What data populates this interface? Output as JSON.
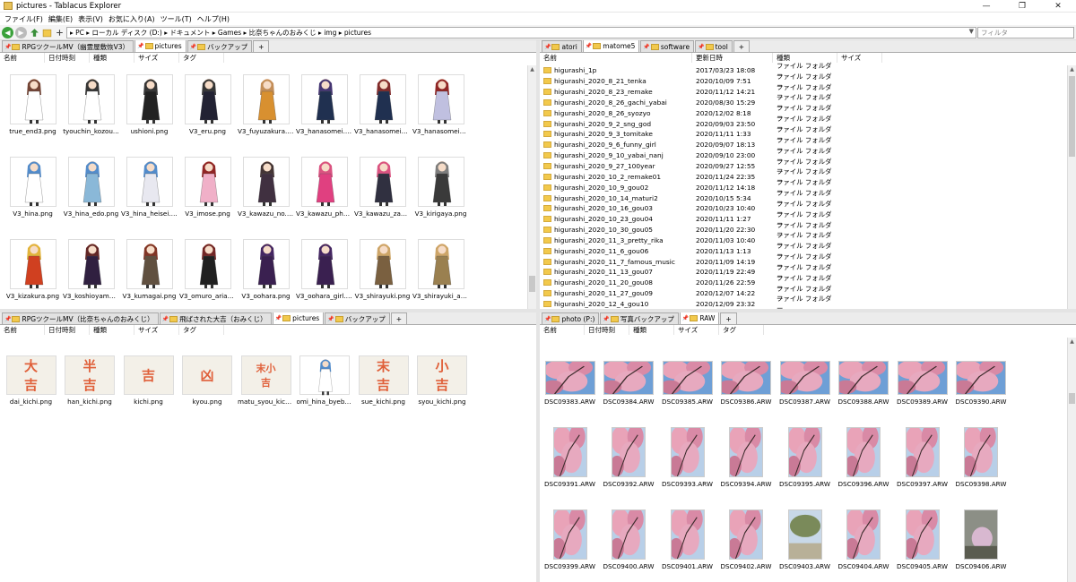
{
  "window": {
    "title": "pictures - Tablacus Explorer",
    "min": "—",
    "max": "❐",
    "close": "✕"
  },
  "menu": [
    "ファイル(F)",
    "編集(E)",
    "表示(V)",
    "お気に入り(A)",
    "ツール(T)",
    "ヘルプ(H)"
  ],
  "address": {
    "path": "▸ PC ▸ ローカル ディスク (D:) ▸ ドキュメント ▸ Games ▸ 比奈ちゃんのおみくじ ▸ img ▸ pictures",
    "filter_placeholder": "フィルタ"
  },
  "columns_icon": [
    "名前",
    "日付時刻",
    "種類",
    "サイズ",
    "タグ"
  ],
  "columns_detail": [
    "名前",
    "更新日時",
    "種類",
    "サイズ"
  ],
  "tl": {
    "tabs": [
      "RPGツクールMV（幽霊屋敷恢V3）",
      "pictures",
      "バックアップ",
      "+"
    ],
    "active": 1,
    "files": [
      "true_end3.png",
      "tyouchin_kozou...",
      "ushioni.png",
      "V3_eru.png",
      "V3_fuyuzakura.png",
      "V3_hanasomei.png",
      "V3_hanasomei_k...",
      "V3_hanasomei_s...",
      "V3_hina.png",
      "V3_hina_edo.png",
      "V3_hina_heisei.png",
      "V3_imose.png",
      "V3_kawazu_no.png",
      "V3_kawazu_phot...",
      "V3_kawazu_zakur...",
      "V3_kirigaya.png",
      "V3_kizakura.png",
      "V3_koshioyama....",
      "V3_kumagai.png",
      "V3_omuro_ariake...",
      "V3_oohara.png",
      "V3_oohara_girl.png",
      "V3_shirayuki.png",
      "V3_shirayuki_ase..."
    ]
  },
  "tr": {
    "tabs": [
      "atori",
      "matome5",
      "software",
      "tool",
      "+"
    ],
    "active": 1,
    "rows": [
      [
        "higurashi_1p",
        "2017/03/23 18:08"
      ],
      [
        "higurashi_2020_8_21_tenka",
        "2020/10/09 7:51"
      ],
      [
        "higurashi_2020_8_23_remake",
        "2020/11/12 14:21"
      ],
      [
        "higurashi_2020_8_26_gachi_yabai",
        "2020/08/30 15:29"
      ],
      [
        "higurashi_2020_8_26_syozyo",
        "2020/12/02 8:18"
      ],
      [
        "higurashi_2020_9_2_sng_god",
        "2020/09/03 23:50"
      ],
      [
        "higurashi_2020_9_3_tomitake",
        "2020/11/11 1:33"
      ],
      [
        "higurashi_2020_9_6_funny_girl",
        "2020/09/07 18:13"
      ],
      [
        "higurashi_2020_9_10_yabai_nanj",
        "2020/09/10 23:00"
      ],
      [
        "higurashi_2020_9_27_100year",
        "2020/09/27 12:55"
      ],
      [
        "higurashi_2020_10_2_remake01",
        "2020/11/24 22:35"
      ],
      [
        "higurashi_2020_10_9_gou02",
        "2020/11/12 14:18"
      ],
      [
        "higurashi_2020_10_14_maturi2",
        "2020/10/15 5:34"
      ],
      [
        "higurashi_2020_10_16_gou03",
        "2020/10/23 10:40"
      ],
      [
        "higurashi_2020_10_23_gou04",
        "2020/11/11 1:27"
      ],
      [
        "higurashi_2020_10_30_gou05",
        "2020/11/20 22:30"
      ],
      [
        "higurashi_2020_11_3_pretty_rika",
        "2020/11/03 10:40"
      ],
      [
        "higurashi_2020_11_6_gou06",
        "2020/11/13 1:13"
      ],
      [
        "higurashi_2020_11_7_famous_music",
        "2020/11/09 14:19"
      ],
      [
        "higurashi_2020_11_13_gou07",
        "2020/11/19 22:49"
      ],
      [
        "higurashi_2020_11_20_gou08",
        "2020/11/26 22:59"
      ],
      [
        "higurashi_2020_11_27_gou09",
        "2020/12/07 14:22"
      ],
      [
        "higurashi_2020_12_4_gou10",
        "2020/12/09 23:32"
      ]
    ],
    "type": "ファイル フォルダー"
  },
  "bl": {
    "tabs": [
      "RPGツクールMV（比奈ちゃんのおみくじ）",
      "飛ばされた大吉（おみくじ）",
      "pictures",
      "バックアップ",
      "+"
    ],
    "active": 2,
    "files": [
      "dai_kichi.png",
      "han_kichi.png",
      "kichi.png",
      "kyou.png",
      "matu_syou_kichi...",
      "omi_hina_byebye...",
      "sue_kichi.png",
      "syou_kichi.png"
    ],
    "glyphs": [
      "大吉",
      "半吉",
      "吉",
      "凶",
      "末小吉",
      "",
      "末吉",
      "小吉"
    ]
  },
  "br": {
    "tabs": [
      "photo (P:)",
      "写真バックアップ",
      "RAW",
      "+"
    ],
    "active": 2,
    "files": [
      "DSC09383.ARW",
      "DSC09384.ARW",
      "DSC09385.ARW",
      "DSC09386.ARW",
      "DSC09387.ARW",
      "DSC09388.ARW",
      "DSC09389.ARW",
      "DSC09390.ARW",
      "DSC09391.ARW",
      "DSC09392.ARW",
      "DSC09393.ARW",
      "DSC09394.ARW",
      "DSC09395.ARW",
      "DSC09396.ARW",
      "DSC09397.ARW",
      "DSC09398.ARW",
      "DSC09399.ARW",
      "DSC09400.ARW",
      "DSC09401.ARW",
      "DSC09402.ARW",
      "DSC09403.ARW",
      "DSC09404.ARW",
      "DSC09405.ARW",
      "DSC09406.ARW"
    ]
  },
  "colors": {
    "folder": "#f2c94c",
    "sakura": "#e9a3b8",
    "sky": "#6e9fd6",
    "kuji": "#e0603a"
  }
}
